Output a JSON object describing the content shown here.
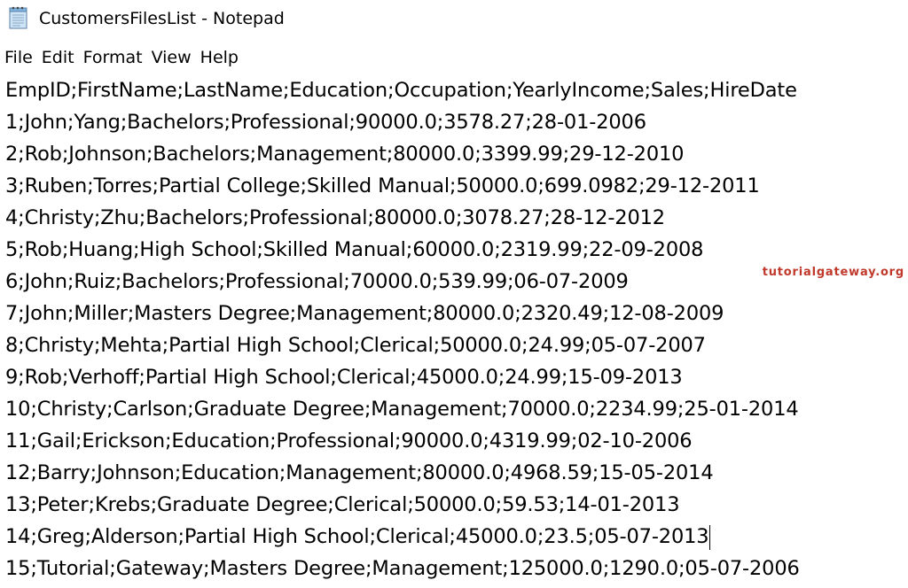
{
  "window": {
    "title": "CustomersFilesList - Notepad",
    "icon": "notepad-icon"
  },
  "menu": {
    "items": [
      "File",
      "Edit",
      "Format",
      "View",
      "Help"
    ]
  },
  "document": {
    "lines": [
      "EmpID;FirstName;LastName;Education;Occupation;YearlyIncome;Sales;HireDate",
      "1;John;Yang;Bachelors;Professional;90000.0;3578.27;28-01-2006",
      "2;Rob;Johnson;Bachelors;Management;80000.0;3399.99;29-12-2010",
      "3;Ruben;Torres;Partial College;Skilled Manual;50000.0;699.0982;29-12-2011",
      "4;Christy;Zhu;Bachelors;Professional;80000.0;3078.27;28-12-2012",
      "5;Rob;Huang;High School;Skilled Manual;60000.0;2319.99;22-09-2008",
      "6;John;Ruiz;Bachelors;Professional;70000.0;539.99;06-07-2009",
      "7;John;Miller;Masters Degree;Management;80000.0;2320.49;12-08-2009",
      "8;Christy;Mehta;Partial High School;Clerical;50000.0;24.99;05-07-2007",
      "9;Rob;Verhoff;Partial High School;Clerical;45000.0;24.99;15-09-2013",
      "10;Christy;Carlson;Graduate Degree;Management;70000.0;2234.99;25-01-2014",
      "11;Gail;Erickson;Education;Professional;90000.0;4319.99;02-10-2006",
      "12;Barry;Johnson;Education;Management;80000.0;4968.59;15-05-2014",
      "13;Peter;Krebs;Graduate Degree;Clerical;50000.0;59.53;14-01-2013",
      "14;Greg;Alderson;Partial High School;Clerical;45000.0;23.5;05-07-2013",
      "15;Tutorial;Gateway;Masters Degree;Management;125000.0;1290.0;05-07-2006"
    ]
  },
  "watermark": {
    "text": "tutorialgateway.org",
    "color": "#c0392b"
  }
}
